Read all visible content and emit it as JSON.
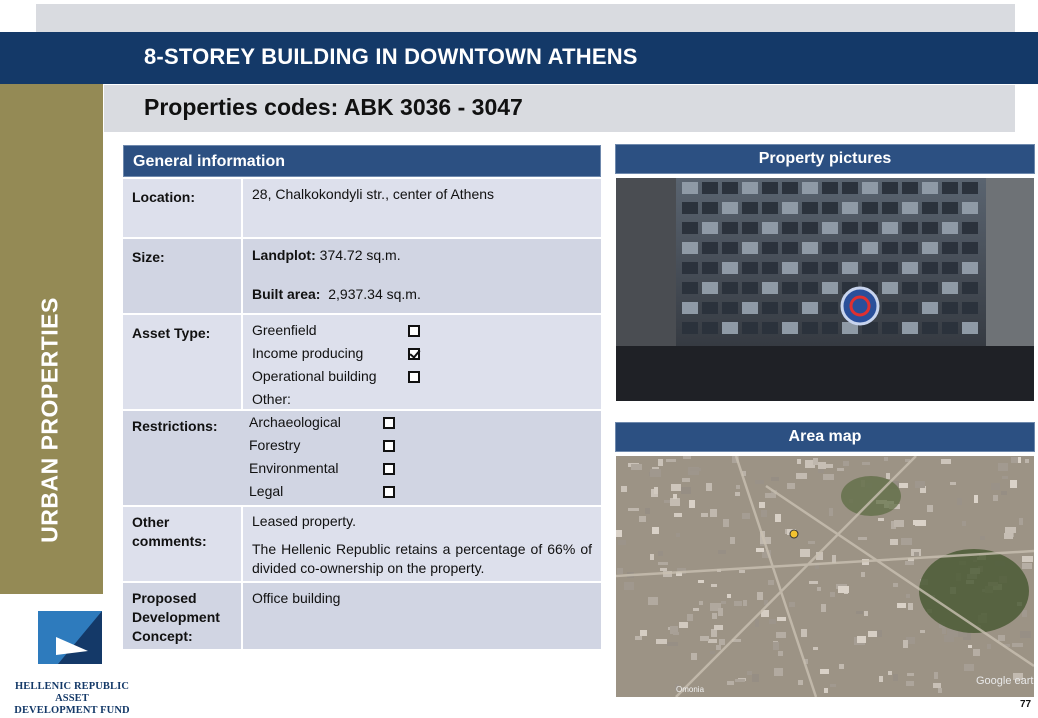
{
  "title": "8-STOREY BUILDING IN DOWNTOWN ATHENS",
  "subtitle": "Properties codes: ABK 3036 - 3047",
  "side_label": "URBAN PROPERTIES",
  "org": {
    "line1": "HELLENIC REPUBLIC ASSET",
    "line2": "DEVELOPMENT FUND"
  },
  "general": {
    "header": "General information",
    "location": {
      "label": "Location:",
      "value": "28, Chalkokondyli  str., center of Athens"
    },
    "size": {
      "label": "Size:",
      "landplot_label": "Landplot:",
      "landplot_value": "374.72 sq.m.",
      "built_label": "Built area:",
      "built_value": "2,937.34 sq.m."
    },
    "asset_type": {
      "label": "Asset Type:",
      "options": [
        {
          "label": "Greenfield",
          "checked": false
        },
        {
          "label": "Income producing",
          "checked": true
        },
        {
          "label": "Operational building",
          "checked": false
        }
      ],
      "other": "Other:"
    },
    "restrictions": {
      "label": "Restrictions:",
      "options": [
        {
          "label": "Archaeological",
          "checked": false
        },
        {
          "label": "Forestry",
          "checked": false
        },
        {
          "label": "Environmental",
          "checked": false
        },
        {
          "label": "Legal",
          "checked": false
        }
      ]
    },
    "other_comments": {
      "label_line1": "Other",
      "label_line2": "comments:",
      "text1": "Leased property.",
      "text2": "The Hellenic Republic retains a percentage of 66% of divided co-ownership on the property."
    },
    "proposed": {
      "label_line1": "Proposed",
      "label_line2": "Development",
      "label_line3": "Concept:",
      "value": "Office building"
    }
  },
  "pictures_header": "Property pictures",
  "map_header": "Area map",
  "map_labels": [
    "Google earth",
    "Omonia"
  ],
  "page_number": "77",
  "colors": {
    "navy": "#143968",
    "panel_blue": "#2c5082",
    "olive": "#948a55",
    "grey": "#d9dbe0",
    "row": "#d1d5e3"
  }
}
